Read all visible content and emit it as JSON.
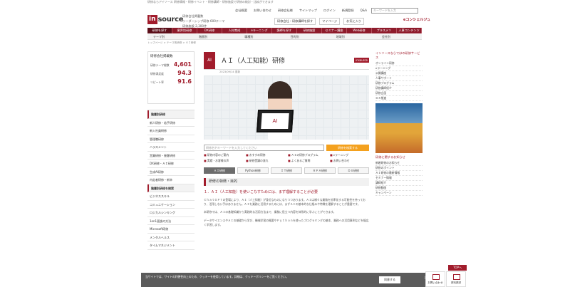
{
  "header": {
    "strip": "研修ならアイソース 研修情報・研修イベント・研修講師・研修施設で研修の検討・比較ができます",
    "logo_in": "in",
    "logo_source": "source",
    "info_line1": "研修会社掲載数",
    "info_line2": "リーダーシップ研修 600テーマ",
    "info_line3": "研修施設 2,300件",
    "toplinks": [
      "会社概要",
      "お問い合わせ",
      "研修会社様",
      "サイトマップ",
      "ログイン",
      "新規登録",
      "Q&A"
    ],
    "search_placeholder": "キーワードを入力",
    "btn_recommend": "研修会社・研修講師を探す",
    "btn_mypage": "マイページ",
    "btn_favorite": "お気に入り",
    "elogo": "eコンシェルジュ"
  },
  "nav": [
    "研修を探す",
    "業界別研修",
    "DX研修",
    "人材育成",
    "eラーニング",
    "講師を探す",
    "研修施設",
    "セミナー講座",
    "Web研修",
    "プラスメソ",
    "人事コンテンツ"
  ],
  "subnav": [
    "テーマ別",
    "階層別",
    "職種別",
    "目的別",
    "地域別",
    "会社別"
  ],
  "breadcrumb": "トップページ > テーマ別研修 > ＡＩ研修",
  "sidebar": {
    "stats_title": "研修会社掲載数",
    "stats": [
      {
        "label": "研修テーマ総数",
        "value": "4,601"
      },
      {
        "label": "研修満足度",
        "value": "94.3"
      },
      {
        "label": "リピート率",
        "value": "91.6"
      }
    ],
    "menu": [
      "階層別研修",
      "新人研修・若手研修",
      "新入社員研修",
      "管理職研修",
      "ハラスメント",
      "営業研修・接客研修",
      "DX研修・ＡＩ研修",
      "生成AI研修",
      "内定者研修・新卒",
      "階層別研修を検索",
      "ビジネススキル",
      "コミュニケーション",
      "ロジカルシンキング",
      "1on1面談の方法",
      "Microsoft研修",
      "メンタルヘルス",
      "タイムマネジメント"
    ]
  },
  "main": {
    "icon": "AI",
    "title": "ＡＩ（人工知能）研修",
    "badge": "insource",
    "date": "2023/09/14 更新",
    "hero_screen": "AI",
    "search_placeholder": "研修名やキーワードを入力してください",
    "search_button": "研修を検索する",
    "chips": [
      "研修内容のご案内",
      "おすすめ研修",
      "ＡＩの研修プログラム",
      "eラーニング",
      "実績・お客様の声",
      "研修受講の流れ",
      "よくあるご質問",
      "お問い合わせ"
    ],
    "tabs": [
      "ＡＩ研修",
      "Python研修",
      "ＩＴ研修",
      "ＲＰＡ研修",
      "ＤＸ研修"
    ],
    "section": "研修の特徴・目的",
    "lead": "１．ＡＩ（人工知能）を使いこなすためには、まず理解することが必要",
    "para1": "ＣｈａｔＧＰＴの登場により、ＡＩ（人工知能）が身近なものになりつつあります。ＡＩは様々な業務を効率化する可能性を持っており、活用しない手はありません。ＡＩを業務に活用するためには、まずＡＩの基本的な仕組みや特徴を理解することが重要です。",
    "para2": "本研修では、ＡＩの基礎知識から実践的な活用方法まで、業務に役立つ内容を体系的に学ぶことができます。",
    "para3": "データサイエンスやＡＩの基礎から学び、機械学習の概要やＰｙｔｈｏｎを使ったプログラミングの基本、業務への活用事例などを幅広く学習します。"
  },
  "right": {
    "heading": "インソースならではの研修サービス",
    "items": [
      "オンライン研修",
      "eラーニング",
      "公開講座",
      "人事サポート",
      "研修プログラム",
      "研修講師紹介",
      "研修企画",
      "ＤＸ推進"
    ],
    "news_heading": "研修に関するお知らせ",
    "news": [
      "新着研修のお知らせ",
      "研修のポイント",
      "ＡＩ研修の最新情報",
      "セミナー情報",
      "講師紹介",
      "研修動画",
      "キャンペーン"
    ]
  },
  "cookie": {
    "text": "当サイトでは、サイトの利便性向上のため、クッキーを使用しています。詳細は、クッキーポリシーをご覧ください。",
    "accept": "同意する",
    "close": "×"
  },
  "fab": {
    "to_top": "TOPへ",
    "contact": "お問い合わせ",
    "document": "資料請求"
  }
}
